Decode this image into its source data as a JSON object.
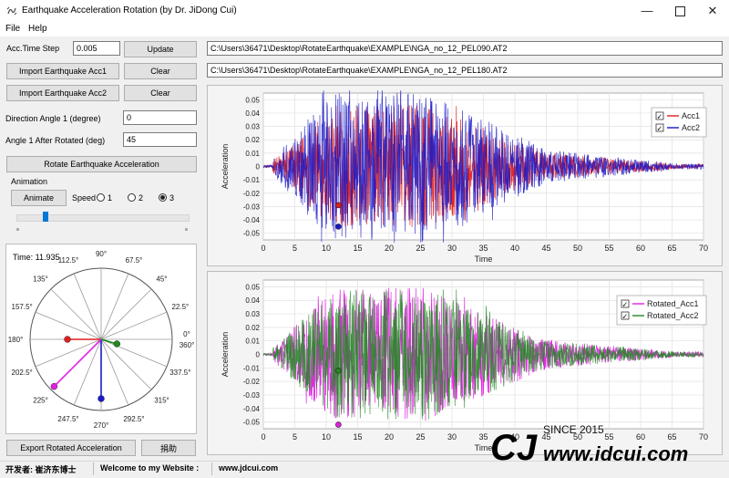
{
  "window": {
    "title": "Earthquake Acceleration Rotation (by Dr. JiDong Cui)"
  },
  "menu": [
    "File",
    "Help"
  ],
  "controls": {
    "acc_time_step_label": "Acc.Time Step",
    "acc_time_step_value": "0.005",
    "update_label": "Update",
    "import_acc1_label": "Import Earthquake Acc1",
    "import_acc2_label": "Import Earthquake Acc2",
    "clear_label": "Clear",
    "acc1_path": "C:\\Users\\36471\\Desktop\\RotateEarthquake\\EXAMPLE\\NGA_no_12_PEL090.AT2",
    "acc2_path": "C:\\Users\\36471\\Desktop\\RotateEarthquake\\EXAMPLE\\NGA_no_12_PEL180.AT2",
    "direction_angle_label": "Direction Angle 1 (degree)",
    "direction_angle_value": "0",
    "angle_after_label": "Angle 1 After Rotated (deg)",
    "angle_after_value": "45",
    "rotate_label": "Rotate Earthquake Acceleration",
    "animation_group": "Animation",
    "animate_label": "Animate",
    "speed_label": "Speed",
    "speed_options": [
      "1",
      "2",
      "3"
    ],
    "speed_selected": "3",
    "slider_value": 0.17,
    "export_label": "Export Rotated Acceleration",
    "donate_label": "捐助"
  },
  "polar": {
    "time_label": "Time: 11.935",
    "angle_labels": [
      "0°",
      "22.5°",
      "45°",
      "67.5°",
      "90°",
      "112.5°",
      "135°",
      "157.5°",
      "180°",
      "202.5°",
      "225°",
      "247.5°",
      "270°",
      "292.5°",
      "315°",
      "337.5°",
      "360°"
    ],
    "colors": {
      "acc1": "#e01e1e",
      "acc2": "#1a1ac8",
      "rot1": "#e020e0",
      "rot2": "#1e8a1e"
    }
  },
  "status": {
    "publisher": "开发者: 崔济东博士",
    "welcome": "Welcome to my Website :",
    "site": "www.jdcui.com"
  },
  "watermark": {
    "text": "www.jdcui.com",
    "since": "SINCE 2015"
  },
  "chart_data": [
    {
      "type": "line",
      "title": "",
      "xlabel": "Time",
      "ylabel": "Acceleration",
      "xlim": [
        0,
        70
      ],
      "ylim": [
        -0.055,
        0.055
      ],
      "x_ticks": [
        0,
        5,
        10,
        15,
        20,
        25,
        30,
        35,
        40,
        45,
        50,
        55,
        60,
        65,
        70
      ],
      "y_ticks": [
        0.05,
        0.04,
        0.03,
        0.02,
        0.01,
        0,
        -0.01,
        -0.02,
        -0.03,
        -0.04,
        -0.05
      ],
      "y_tick_labels": [
        "0.05",
        "0.04",
        "0.03",
        "0.02",
        "0.01",
        "0",
        "-0.01",
        "-0.02",
        "-0.03",
        "-0.04",
        "-0.05"
      ],
      "grid": true,
      "legend": "top-right",
      "series": [
        {
          "name": "Acc1",
          "color": "#e01e1e",
          "peak": 0.046,
          "duration": 70
        },
        {
          "name": "Acc2",
          "color": "#1a1ac8",
          "peak": 0.057,
          "duration": 70
        }
      ],
      "markers": [
        {
          "series": "Acc1",
          "x": 11.935,
          "y": -0.029
        },
        {
          "series": "Acc2",
          "x": 11.935,
          "y": -0.045
        }
      ]
    },
    {
      "type": "line",
      "title": "",
      "xlabel": "Time",
      "ylabel": "Acceleration",
      "xlim": [
        0,
        70
      ],
      "ylim": [
        -0.055,
        0.055
      ],
      "x_ticks": [
        0,
        5,
        10,
        15,
        20,
        25,
        30,
        35,
        40,
        45,
        50,
        55,
        60,
        65,
        70
      ],
      "y_ticks": [
        0.05,
        0.04,
        0.03,
        0.02,
        0.01,
        0,
        -0.01,
        -0.02,
        -0.03,
        -0.04,
        -0.05
      ],
      "y_tick_labels": [
        "0.05",
        "0.04",
        "0.03",
        "0.02",
        "0.01",
        "0",
        "-0.01",
        "-0.02",
        "-0.03",
        "-0.04",
        "-0.05"
      ],
      "grid": true,
      "legend": "right",
      "series": [
        {
          "name": "Rotated_Acc1",
          "color": "#e020e0",
          "peak": 0.049,
          "duration": 70
        },
        {
          "name": "Rotated_Acc2",
          "color": "#1e8a1e",
          "peak": 0.048,
          "duration": 70
        }
      ],
      "markers": [
        {
          "series": "Rotated_Acc1",
          "x": 11.935,
          "y": -0.052
        },
        {
          "series": "Rotated_Acc2",
          "x": 11.935,
          "y": -0.012
        }
      ]
    }
  ]
}
